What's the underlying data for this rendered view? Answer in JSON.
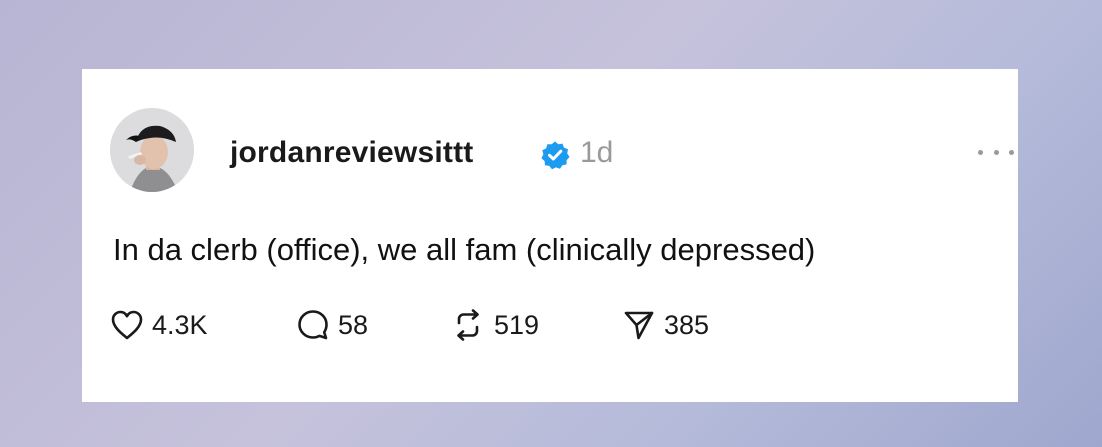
{
  "post": {
    "username": "jordanreviewsittt",
    "timestamp": "1d",
    "verified": true,
    "text": "In da clerb (office), we all fam (clinically depressed)",
    "avatar_icon": "profile-photo"
  },
  "actions": {
    "likes": {
      "icon": "heart-icon",
      "count": "4.3K"
    },
    "replies": {
      "icon": "comment-icon",
      "count": "58"
    },
    "reposts": {
      "icon": "repost-icon",
      "count": "519"
    },
    "shares": {
      "icon": "send-icon",
      "count": "385"
    }
  },
  "colors": {
    "verified_badge": "#1d9bf0",
    "timestamp": "#9a9a9a",
    "text": "#111111",
    "card_background": "#ffffff"
  }
}
